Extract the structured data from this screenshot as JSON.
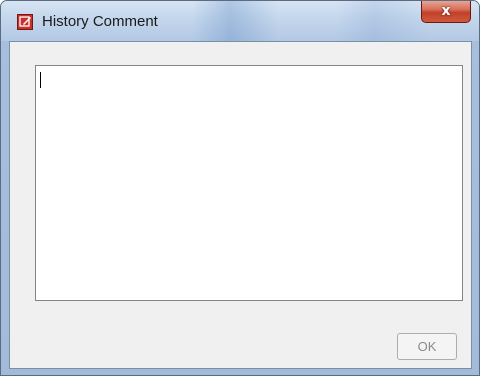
{
  "window": {
    "title": "History Comment",
    "close_glyph": "x",
    "app_icon": "edit-pencil-icon"
  },
  "comment": {
    "value": "",
    "placeholder": ""
  },
  "buttons": {
    "ok_label": "OK",
    "ok_enabled": false
  },
  "colors": {
    "titlebar": "#b9cde6",
    "close_button": "#c2402a",
    "client_background": "#f0f0f0"
  }
}
